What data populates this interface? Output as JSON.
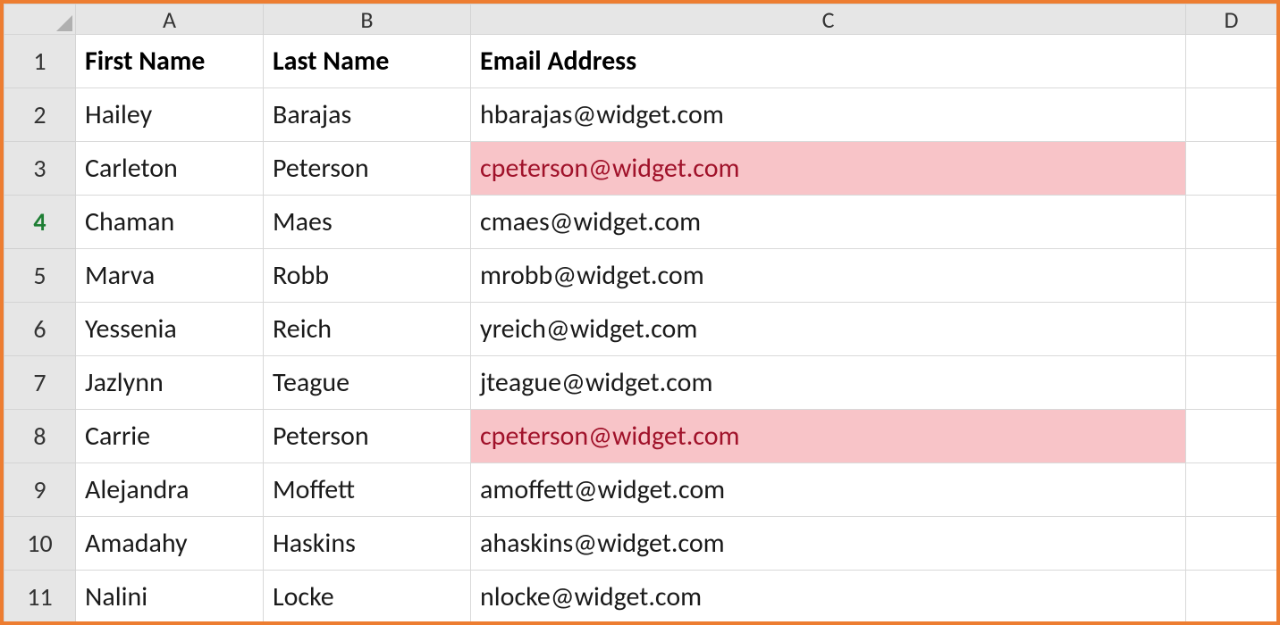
{
  "columns": [
    "A",
    "B",
    "C",
    "D"
  ],
  "activeRow": 4,
  "headers": {
    "a": "First Name",
    "b": "Last Name",
    "c": "Email Address"
  },
  "rows": [
    {
      "n": 1,
      "a": "First Name",
      "b": "Last Name",
      "c": "Email Address",
      "d": "",
      "isHeader": true
    },
    {
      "n": 2,
      "a": "Hailey",
      "b": "Barajas",
      "c": "hbarajas@widget.com",
      "d": ""
    },
    {
      "n": 3,
      "a": "Carleton",
      "b": "Peterson",
      "c": "cpeterson@widget.com",
      "d": "",
      "highlightC": true
    },
    {
      "n": 4,
      "a": "Chaman",
      "b": "Maes",
      "c": "cmaes@widget.com",
      "d": ""
    },
    {
      "n": 5,
      "a": "Marva",
      "b": "Robb",
      "c": "mrobb@widget.com",
      "d": ""
    },
    {
      "n": 6,
      "a": "Yessenia",
      "b": "Reich",
      "c": "yreich@widget.com",
      "d": ""
    },
    {
      "n": 7,
      "a": "Jazlynn",
      "b": "Teague",
      "c": "jteague@widget.com",
      "d": ""
    },
    {
      "n": 8,
      "a": "Carrie",
      "b": "Peterson",
      "c": "cpeterson@widget.com",
      "d": "",
      "highlightC": true
    },
    {
      "n": 9,
      "a": "Alejandra",
      "b": "Moffett",
      "c": "amoffett@widget.com",
      "d": ""
    },
    {
      "n": 10,
      "a": "Amadahy",
      "b": "Haskins",
      "c": "ahaskins@widget.com",
      "d": ""
    },
    {
      "n": 11,
      "a": "Nalini",
      "b": "Locke",
      "c": "nlocke@widget.com",
      "d": ""
    }
  ]
}
